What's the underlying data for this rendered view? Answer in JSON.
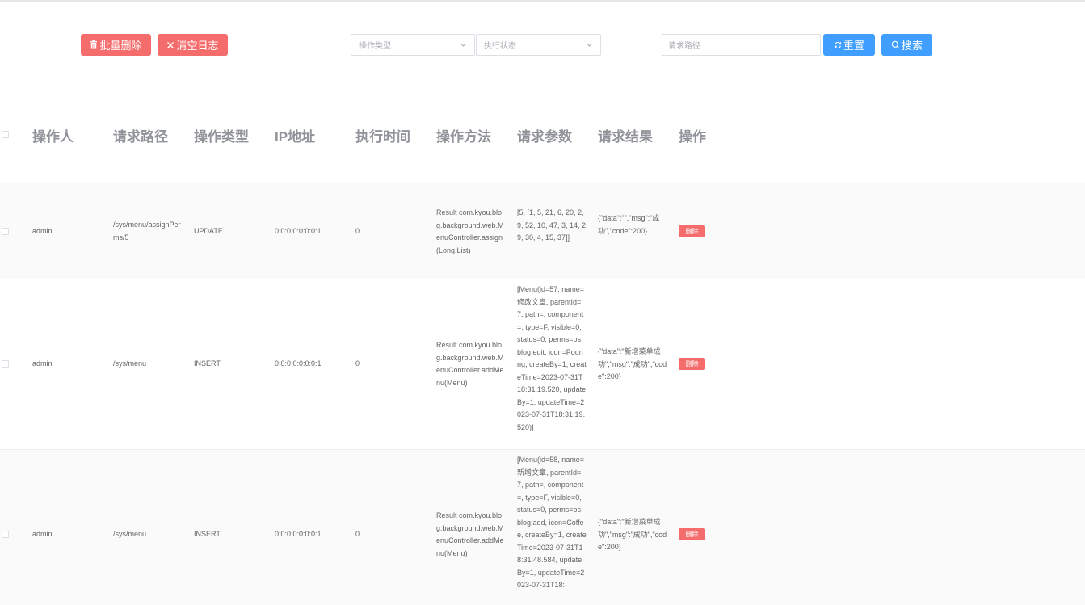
{
  "toolbar": {
    "batch_delete_label": "批量删除",
    "clear_log_label": "清空日志",
    "op_type_placeholder": "操作类型",
    "exec_status_placeholder": "执行状态",
    "path_placeholder": "请求路径",
    "reset_label": "重置",
    "search_label": "搜索"
  },
  "table": {
    "columns": [
      "操作人",
      "请求路径",
      "操作类型",
      "IP地址",
      "执行时间",
      "操作方法",
      "请求参数",
      "请求结果",
      "操作"
    ],
    "rows": [
      {
        "operator": "admin",
        "path": "/sys/menu/assignPerms/5",
        "type": "UPDATE",
        "ip": "0:0:0:0:0:0:0:1",
        "time": "0",
        "method": "Result com.kyou.blog.background.web.MenuController.assign(Long,List)",
        "params": "[5, [1, 5, 21, 6, 20, 2, 9, 52, 10, 47, 3, 14, 29, 30, 4, 15, 37]]",
        "result": "{\"data\":\"\",\"msg\":\"成功\",\"code\":200}",
        "action": "删除"
      },
      {
        "operator": "admin",
        "path": "/sys/menu",
        "type": "INSERT",
        "ip": "0:0:0:0:0:0:0:1",
        "time": "0",
        "method": "Result com.kyou.blog.background.web.MenuController.addMenu(Menu)",
        "params": "[Menu(id=57, name=修改文章, parentId=7, path=, component=, type=F, visible=0, status=0, perms=os:blog:edit, icon=Pouring, createBy=1, createTime=2023-07-31T18:31:19.520, updateBy=1, updateTime=2023-07-31T18:31:19.520)]",
        "result": "{\"data\":\"新增菜单成功\",\"msg\":\"成功\",\"code\":200}",
        "action": "删除"
      },
      {
        "operator": "admin",
        "path": "/sys/menu",
        "type": "INSERT",
        "ip": "0:0:0:0:0:0:0:1",
        "time": "0",
        "method": "Result com.kyou.blog.background.web.MenuController.addMenu(Menu)",
        "params": "[Menu(id=58, name=新增文章, parentId=7, path=, component=, type=F, visible=0, status=0, perms=os:blog:add, icon=Coffee, createBy=1, createTime=2023-07-31T18:31:48.584, updateBy=1, updateTime=2023-07-31T18:",
        "result": "{\"data\":\"新增菜单成功\",\"msg\":\"成功\",\"code\":200}",
        "action": "删除"
      }
    ]
  },
  "colors": {
    "danger": "#f56c6c",
    "primary": "#409eff",
    "header_text": "#909399",
    "stripe": "#fafafa"
  }
}
